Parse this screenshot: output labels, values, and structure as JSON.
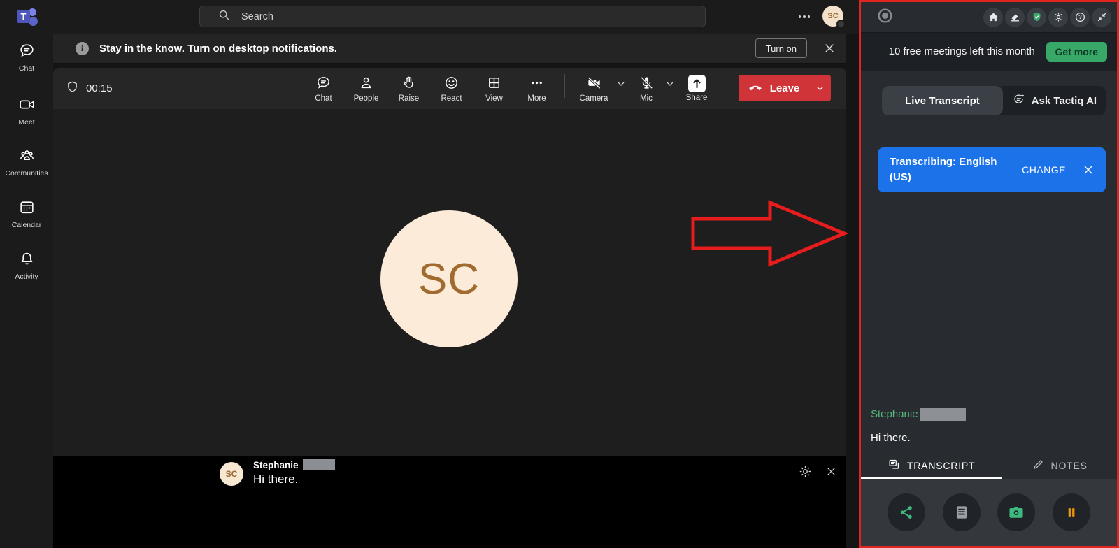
{
  "sidebar": {
    "items": [
      {
        "label": "Chat"
      },
      {
        "label": "Meet"
      },
      {
        "label": "Communities"
      },
      {
        "label": "Calendar"
      },
      {
        "label": "Activity"
      }
    ]
  },
  "topbar": {
    "search_placeholder": "Search",
    "avatar_initials": "SC"
  },
  "notification": {
    "message": "Stay in the know. Turn on desktop notifications.",
    "turn_on_label": "Turn on"
  },
  "toolbar": {
    "timer": "00:15",
    "center_buttons": [
      {
        "label": "Chat"
      },
      {
        "label": "People"
      },
      {
        "label": "Raise"
      },
      {
        "label": "React"
      },
      {
        "label": "View"
      },
      {
        "label": "More"
      }
    ],
    "camera_label": "Camera",
    "mic_label": "Mic",
    "share_label": "Share",
    "leave_label": "Leave"
  },
  "stage": {
    "avatar_initials": "SC"
  },
  "filmstrip": {
    "avatar_initials": "SC",
    "speaker_name": "Stephanie",
    "caption": "Hi there."
  },
  "tactiq": {
    "free_meetings_text": "10 free meetings left this month",
    "get_more_label": "Get more",
    "tab_live": "Live Transcript",
    "tab_ask": "Ask Tactiq AI",
    "transcribing_text": "Transcribing: English (US)",
    "change_label": "CHANGE",
    "speaker_name": "Stephanie",
    "caption": "Hi there.",
    "tab_transcript": "TRANSCRIPT",
    "tab_notes": "NOTES"
  },
  "colors": {
    "panel_border_red": "#e02420",
    "transcribing_blue": "#1c72e8",
    "accent_green": "#38a869",
    "leave_red": "#d13438",
    "pause_orange": "#e8930c",
    "speaker_green": "#56b87b"
  }
}
